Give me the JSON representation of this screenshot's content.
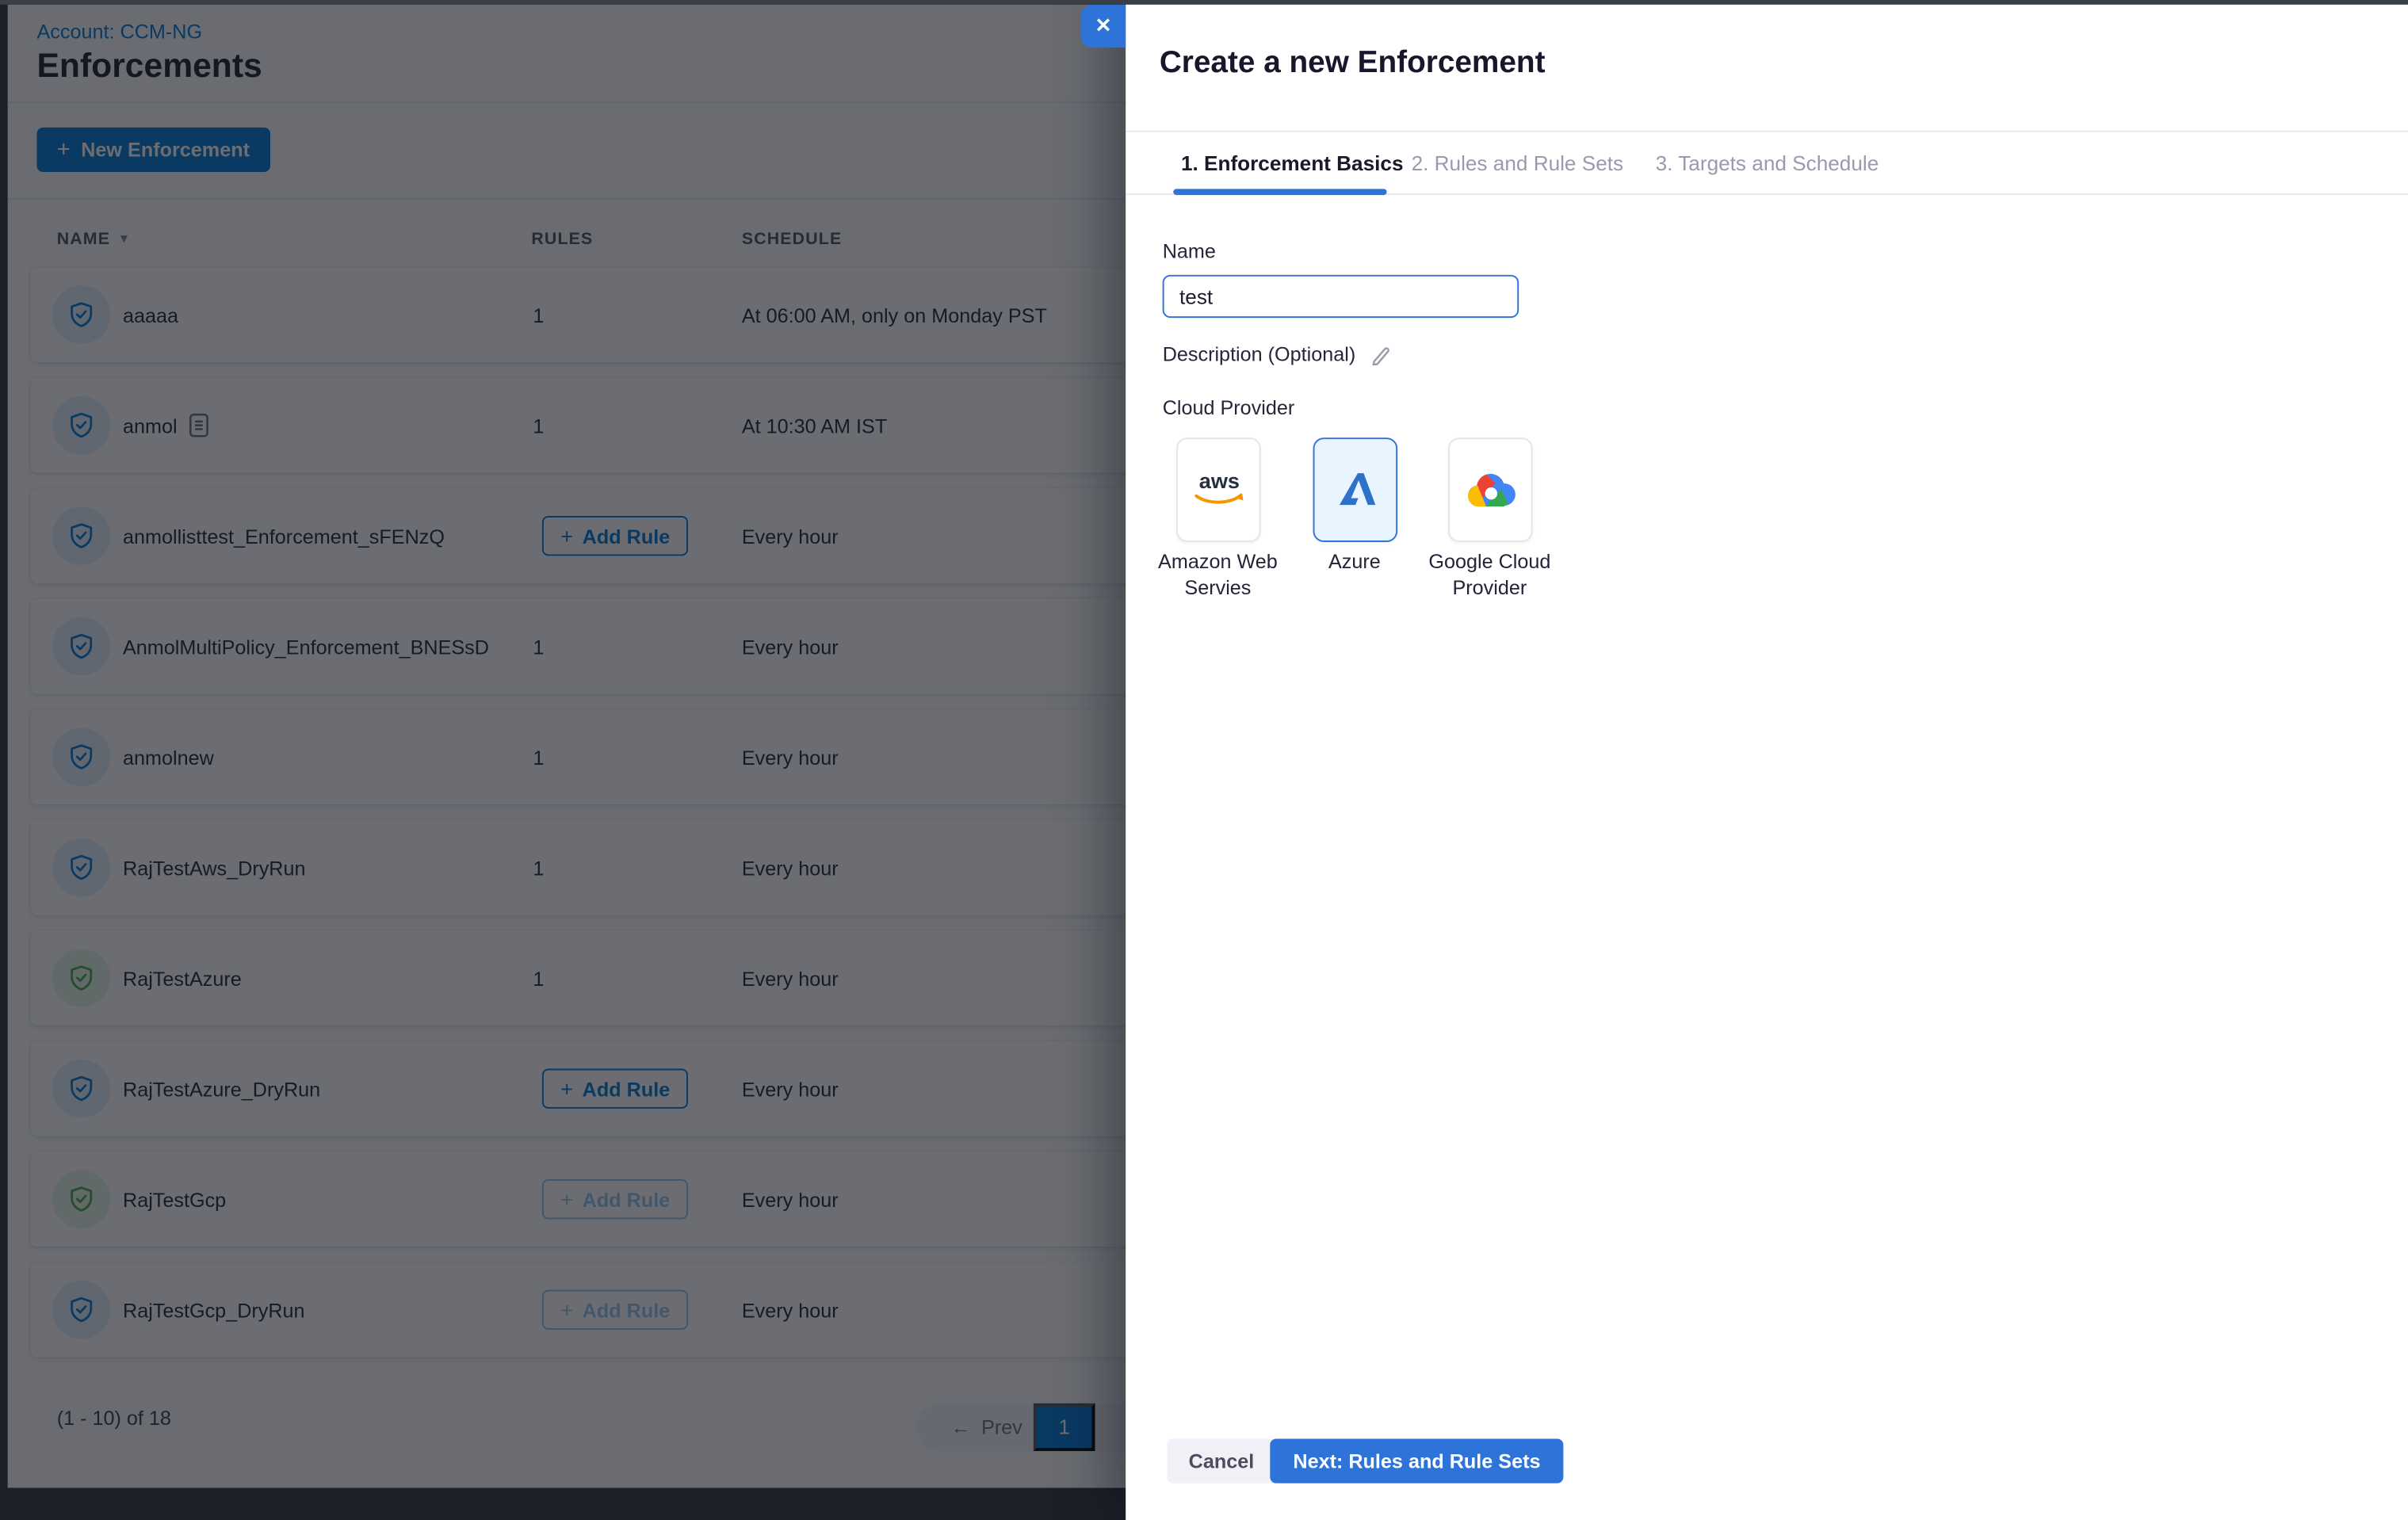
{
  "colors": {
    "primary": "#0278D5",
    "accent": "#2E74D8",
    "scrim": "rgba(16,20,28,0.62)",
    "shield-blue": "#0278D5",
    "shield-green": "#42AB45",
    "aws-orange": "#F79400",
    "aws-dark": "#252F3E",
    "azure-blue": "#2D72C8",
    "gcp-red": "#EA4335",
    "gcp-yellow": "#FBBC05",
    "gcp-green": "#34A853",
    "gcp-blue": "#4285F4"
  },
  "page": {
    "breadcrumb": "Account: CCM-NG",
    "title": "Enforcements",
    "toolbar": {
      "new_enforcement_plus": "+",
      "new_enforcement_label": "New Enforcement"
    },
    "table": {
      "columns": {
        "name": "NAME",
        "rules": "RULES",
        "schedule": "SCHEDULE"
      },
      "sort_caret": "▼",
      "add_rule_plus": "+",
      "add_rule_label": "Add Rule",
      "rows": [
        {
          "name": "aaaaa",
          "rules": "1",
          "schedule": "At 06:00 AM, only on Monday PST"
        },
        {
          "name": "anmol",
          "rules": "1",
          "schedule": "At 10:30 AM IST"
        },
        {
          "name": "anmollisttest_Enforcement_sFENzQ",
          "rules": "",
          "schedule": "Every hour"
        },
        {
          "name": "AnmolMultiPolicy_Enforcement_BNESsD",
          "rules": "1",
          "schedule": "Every hour"
        },
        {
          "name": "anmolnew",
          "rules": "1",
          "schedule": "Every hour"
        },
        {
          "name": "RajTestAws_DryRun",
          "rules": "1",
          "schedule": "Every hour"
        },
        {
          "name": "RajTestAzure",
          "rules": "1",
          "schedule": "Every hour"
        },
        {
          "name": "RajTestAzure_DryRun",
          "rules": "",
          "schedule": "Every hour"
        },
        {
          "name": "RajTestGcp",
          "rules": "",
          "schedule": "Every hour"
        },
        {
          "name": "RajTestGcp_DryRun",
          "rules": "",
          "schedule": "Every hour"
        }
      ]
    },
    "pagination": {
      "summary": "(1 - 10) of 18",
      "prev_arrow": "←",
      "prev_label": "Prev",
      "current_page": "1"
    }
  },
  "drawer": {
    "close_icon": "✕",
    "title": "Create a new Enforcement",
    "tabs": {
      "tab1": "1. Enforcement Basics",
      "tab2": "2. Rules and Rule Sets",
      "tab3": "3. Targets and Schedule"
    },
    "form": {
      "name_label": "Name",
      "name_value": "test",
      "description_label": "Description (Optional)",
      "cloud_provider_label": "Cloud Provider",
      "providers": {
        "aws_label": "Amazon Web Servies",
        "aws_logo_text": "aws",
        "azure_label": "Azure",
        "gcp_label": "Google Cloud Provider"
      }
    },
    "footer": {
      "cancel_label": "Cancel",
      "next_label": "Next: Rules and Rule Sets"
    }
  }
}
